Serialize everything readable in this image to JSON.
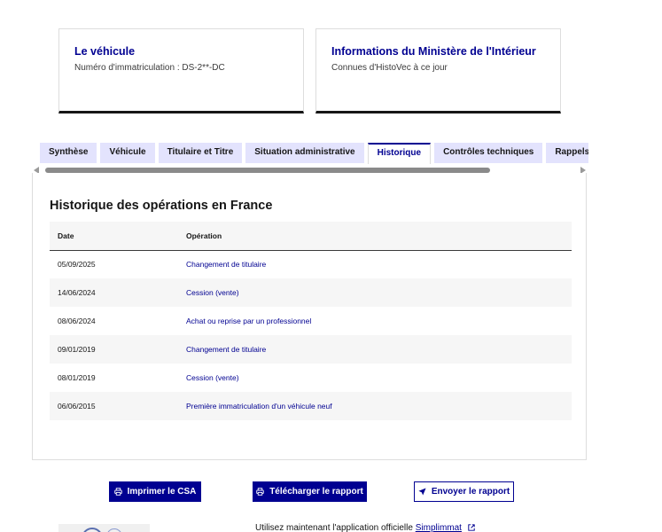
{
  "cards": {
    "vehicle": {
      "title": "Le véhicule",
      "desc": "Numéro d'immatriculation : DS-2**-DC"
    },
    "ministry": {
      "title": "Informations du Ministère de l'Intérieur",
      "desc": "Connues d'HistoVec à ce jour"
    }
  },
  "tabs": [
    {
      "label": "Synthèse",
      "active": false
    },
    {
      "label": "Véhicule",
      "active": false
    },
    {
      "label": "Titulaire et Titre",
      "active": false
    },
    {
      "label": "Situation administrative",
      "active": false
    },
    {
      "label": "Historique",
      "active": true
    },
    {
      "label": "Contrôles techniques",
      "active": false
    },
    {
      "label": "Rappels constructeur",
      "active": false
    }
  ],
  "history": {
    "title": "Historique des opérations en France",
    "columns": {
      "date": "Date",
      "operation": "Opération"
    },
    "rows": [
      {
        "date": "05/09/2025",
        "operation": "Changement de titulaire"
      },
      {
        "date": "14/06/2024",
        "operation": "Cession (vente)"
      },
      {
        "date": "08/06/2024",
        "operation": "Achat ou reprise par un professionnel"
      },
      {
        "date": "09/01/2019",
        "operation": "Changement de titulaire"
      },
      {
        "date": "08/01/2019",
        "operation": "Cession (vente)"
      },
      {
        "date": "06/06/2015",
        "operation": "Première immatriculation d'un véhicule neuf"
      }
    ]
  },
  "actions": {
    "print": "Imprimer le CSA",
    "download": "Télécharger le rapport",
    "send": "Envoyer le rapport"
  },
  "promo": {
    "text": "Utilisez maintenant l'application officielle",
    "link": "Simplimmat"
  },
  "colors": {
    "accent": "#000091",
    "tab_bg": "#e3e3fd",
    "row_alt": "#f6f6f6"
  },
  "icons": {
    "print": "printer-icon",
    "download": "printer-icon",
    "send": "send-arrow-icon",
    "external": "external-link-icon"
  }
}
